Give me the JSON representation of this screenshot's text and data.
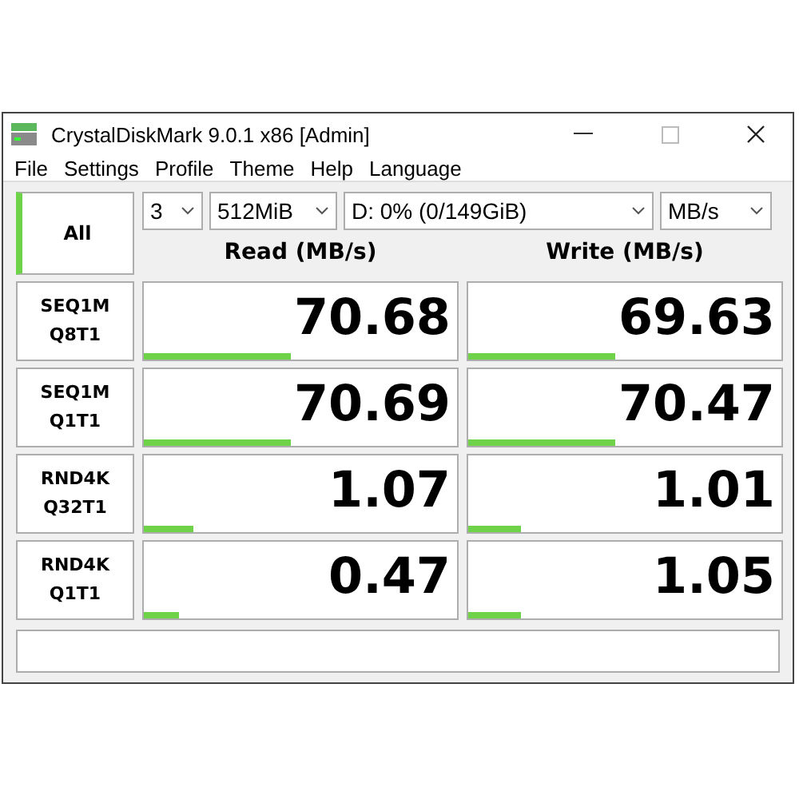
{
  "window": {
    "title": "CrystalDiskMark 9.0.1 x86 [Admin]"
  },
  "menu": [
    "File",
    "Settings",
    "Profile",
    "Theme",
    "Help",
    "Language"
  ],
  "all_button": {
    "label": "All"
  },
  "selectors": [
    {
      "value": "3"
    },
    {
      "value": "512MiB"
    },
    {
      "value": "D: 0% (0/149GiB)"
    },
    {
      "value": "MB/s"
    }
  ],
  "columns": [
    "Read (MB/s)",
    "Write (MB/s)"
  ],
  "tests": [
    {
      "label": [
        "SEQ1M",
        "Q8T1"
      ],
      "read": {
        "value": "70.68",
        "level": 0.47
      },
      "write": {
        "value": "69.63",
        "level": 0.47
      }
    },
    {
      "label": [
        "SEQ1M",
        "Q1T1"
      ],
      "read": {
        "value": "70.69",
        "level": 0.47
      },
      "write": {
        "value": "70.47",
        "level": 0.47
      }
    },
    {
      "label": [
        "RND4K",
        "Q32T1"
      ],
      "read": {
        "value": "1.07",
        "level": 0.16
      },
      "write": {
        "value": "1.01",
        "level": 0.17
      }
    },
    {
      "label": [
        "RND4K",
        "Q1T1"
      ],
      "read": {
        "value": "0.47",
        "level": 0.11
      },
      "write": {
        "value": "1.05",
        "level": 0.17
      }
    }
  ]
}
